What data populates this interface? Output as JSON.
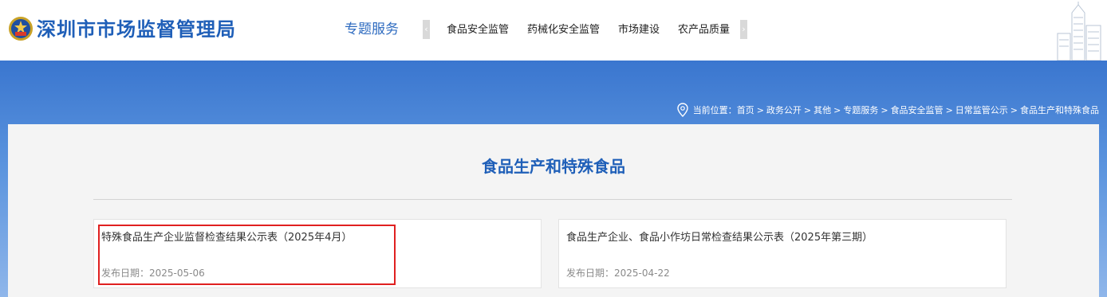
{
  "header": {
    "site_title": "深圳市市场监督管理局",
    "topic_label": "专题服务",
    "nav_items": [
      "食品安全监管",
      "药械化安全监管",
      "市场建设",
      "农产品质量"
    ],
    "nav_prev": "‹",
    "nav_next": "›"
  },
  "breadcrumb": {
    "prefix": "当前位置：",
    "items": [
      "首页",
      "政务公开",
      "其他",
      "专题服务",
      "食品安全监管",
      "日常监管公示",
      "食品生产和特殊食品"
    ],
    "separator": ">"
  },
  "main": {
    "page_title": "食品生产和特殊食品",
    "articles": [
      {
        "title": "特殊食品生产企业监督检查结果公示表（2025年4月）",
        "date_label": "发布日期：",
        "date": "2025-05-06"
      },
      {
        "title": "食品生产企业、食品小作坊日常检查结果公示表（2025年第三期）",
        "date_label": "发布日期：",
        "date": "2025-04-22"
      }
    ]
  },
  "colors": {
    "brand_blue": "#1f5fb8",
    "banner_top": "#3a76cf",
    "highlight": "#e02020"
  },
  "icons": [
    "police-emblem-icon",
    "location-pin-icon",
    "building-illustration"
  ]
}
